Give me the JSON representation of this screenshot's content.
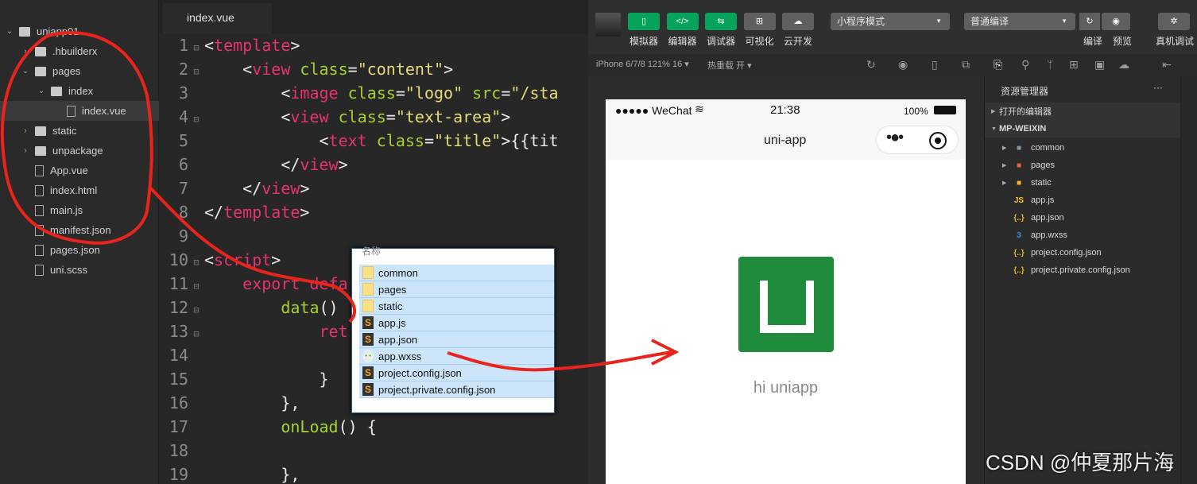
{
  "sidebar": {
    "items": [
      {
        "label": "uniapp01",
        "icon": "project-icon",
        "chev": "⌄",
        "indent": 0
      },
      {
        "label": ".hbuilderx",
        "icon": "folder-icon",
        "chev": "›",
        "indent": 1
      },
      {
        "label": "pages",
        "icon": "folder-icon",
        "chev": "⌄",
        "indent": 1
      },
      {
        "label": "index",
        "icon": "folder-icon",
        "chev": "⌄",
        "indent": 2
      },
      {
        "label": "index.vue",
        "icon": "vue-file-icon",
        "chev": "",
        "indent": 3,
        "selected": true
      },
      {
        "label": "static",
        "icon": "folder-icon",
        "chev": "›",
        "indent": 1
      },
      {
        "label": "unpackage",
        "icon": "folder-icon",
        "chev": "›",
        "indent": 1
      },
      {
        "label": "App.vue",
        "icon": "vue-file-icon",
        "chev": "",
        "indent": 1
      },
      {
        "label": "index.html",
        "icon": "html-file-icon",
        "chev": "",
        "indent": 1
      },
      {
        "label": "main.js",
        "icon": "js-file-icon",
        "chev": "",
        "indent": 1
      },
      {
        "label": "manifest.json",
        "icon": "gear-file-icon",
        "chev": "",
        "indent": 1
      },
      {
        "label": "pages.json",
        "icon": "json-file-icon",
        "chev": "",
        "indent": 1
      },
      {
        "label": "uni.scss",
        "icon": "scss-file-icon",
        "chev": "",
        "indent": 1
      }
    ]
  },
  "editor": {
    "tab": "index.vue",
    "lines": [
      {
        "n": "1",
        "fold": "⊟",
        "indent": 0,
        "tokens": [
          [
            "<",
            "punc"
          ],
          [
            "template",
            "tag"
          ],
          [
            ">",
            "punc"
          ]
        ]
      },
      {
        "n": "2",
        "fold": "⊟",
        "indent": 1,
        "tokens": [
          [
            "<",
            "punc"
          ],
          [
            "view",
            "tag"
          ],
          [
            " class",
            "attr"
          ],
          [
            "=",
            "punc"
          ],
          [
            "\"content\"",
            "str"
          ],
          [
            ">",
            "punc"
          ]
        ]
      },
      {
        "n": "3",
        "fold": "",
        "indent": 2,
        "tokens": [
          [
            "<",
            "punc"
          ],
          [
            "image",
            "tag"
          ],
          [
            " class",
            "attr"
          ],
          [
            "=",
            "punc"
          ],
          [
            "\"logo\"",
            "str"
          ],
          [
            " src",
            "attr"
          ],
          [
            "=",
            "punc"
          ],
          [
            "\"/sta",
            "str"
          ]
        ]
      },
      {
        "n": "4",
        "fold": "⊟",
        "indent": 2,
        "tokens": [
          [
            "<",
            "punc"
          ],
          [
            "view",
            "tag"
          ],
          [
            " class",
            "attr"
          ],
          [
            "=",
            "punc"
          ],
          [
            "\"text-area\"",
            "str"
          ],
          [
            ">",
            "punc"
          ]
        ]
      },
      {
        "n": "5",
        "fold": "",
        "indent": 3,
        "tokens": [
          [
            "<",
            "punc"
          ],
          [
            "text",
            "tag"
          ],
          [
            " class",
            "attr"
          ],
          [
            "=",
            "punc"
          ],
          [
            "\"title\"",
            "str"
          ],
          [
            ">{{tit",
            "punc"
          ]
        ]
      },
      {
        "n": "6",
        "fold": "",
        "indent": 2,
        "tokens": [
          [
            "</",
            "punc"
          ],
          [
            "view",
            "tag"
          ],
          [
            ">",
            "punc"
          ]
        ]
      },
      {
        "n": "7",
        "fold": "",
        "indent": 1,
        "tokens": [
          [
            "</",
            "punc"
          ],
          [
            "view",
            "tag"
          ],
          [
            ">",
            "punc"
          ]
        ]
      },
      {
        "n": "8",
        "fold": "",
        "indent": 0,
        "tokens": [
          [
            "</",
            "punc"
          ],
          [
            "template",
            "tag"
          ],
          [
            ">",
            "punc"
          ]
        ]
      },
      {
        "n": "9",
        "fold": "",
        "indent": 0,
        "tokens": []
      },
      {
        "n": "10",
        "fold": "⊟",
        "indent": 0,
        "tokens": [
          [
            "<",
            "punc"
          ],
          [
            "script",
            "tag"
          ],
          [
            ">",
            "punc"
          ]
        ]
      },
      {
        "n": "11",
        "fold": "⊟",
        "indent": 1,
        "tokens": [
          [
            "export defa",
            "tag"
          ]
        ]
      },
      {
        "n": "12",
        "fold": "⊟",
        "indent": 2,
        "tokens": [
          [
            "data",
            "fn"
          ],
          [
            "()",
            "punc"
          ]
        ]
      },
      {
        "n": "13",
        "fold": "⊟",
        "indent": 3,
        "tokens": [
          [
            "ret",
            "tag"
          ]
        ]
      },
      {
        "n": "14",
        "fold": "",
        "indent": 0,
        "tokens": []
      },
      {
        "n": "15",
        "fold": "",
        "indent": 3,
        "tokens": [
          [
            "}",
            "punc"
          ]
        ]
      },
      {
        "n": "16",
        "fold": "",
        "indent": 2,
        "tokens": [
          [
            "},",
            "punc"
          ]
        ]
      },
      {
        "n": "17",
        "fold": "",
        "indent": 2,
        "tokens": [
          [
            "onLoad",
            "fn"
          ],
          [
            "() {",
            "punc"
          ]
        ]
      },
      {
        "n": "18",
        "fold": "",
        "indent": 0,
        "tokens": []
      },
      {
        "n": "19",
        "fold": "",
        "indent": 2,
        "tokens": [
          [
            "},",
            "punc"
          ]
        ]
      }
    ]
  },
  "popup": {
    "header": "名称",
    "rows": [
      {
        "label": "common",
        "type": "f"
      },
      {
        "label": "pages",
        "type": "f"
      },
      {
        "label": "static",
        "type": "f"
      },
      {
        "label": "app.js",
        "type": "s"
      },
      {
        "label": "app.json",
        "type": "s"
      },
      {
        "label": "app.wxss",
        "type": "w"
      },
      {
        "label": "project.config.json",
        "type": "s"
      },
      {
        "label": "project.private.config.json",
        "type": "s"
      }
    ]
  },
  "devtools": {
    "toolbar": {
      "buttons": [
        {
          "label": "模拟器",
          "icon": "phone-icon",
          "glyph": "▯",
          "green": true
        },
        {
          "label": "编辑器",
          "icon": "code-icon",
          "glyph": "</>",
          "green": true
        },
        {
          "label": "调试器",
          "icon": "sliders-icon",
          "glyph": "⇆",
          "green": true
        },
        {
          "label": "可视化",
          "icon": "layout-icon",
          "glyph": "⊞",
          "green": false
        },
        {
          "label": "云开发",
          "icon": "cloud-icon",
          "glyph": "☁",
          "green": false
        }
      ],
      "mode_select": "小程序模式",
      "compile_select": "普通编译",
      "compile": "编译",
      "preview": "预览",
      "remote_debug": "真机调试"
    },
    "subbar": {
      "device": "iPhone 6/7/8 121% 16 ▾",
      "hot_reload": "热重载 开 ▾"
    },
    "phone": {
      "signal": "●●●●● WeChat",
      "time": "21:38",
      "battery": "100%",
      "nav_title": "uni-app",
      "greeting": "hi uniapp",
      "logo_color": "#1f8c3b"
    },
    "explorer": {
      "title": "资源管理器",
      "more": "···",
      "open_editors": "打开的编辑器",
      "project": "MP-WEIXIN",
      "items": [
        {
          "label": "common",
          "icon": "folder-icon",
          "glyph": "■",
          "color": "#8a97a3",
          "tri": "▶"
        },
        {
          "label": "pages",
          "icon": "pages-folder-icon",
          "glyph": "■",
          "color": "#e8643c",
          "tri": "▶"
        },
        {
          "label": "static",
          "icon": "static-folder-icon",
          "glyph": "■",
          "color": "#f3b52a",
          "tri": "▶"
        },
        {
          "label": "app.js",
          "icon": "js-icon",
          "glyph": "JS",
          "color": "#f3c12a",
          "tri": ""
        },
        {
          "label": "app.json",
          "icon": "json-icon",
          "glyph": "{..}",
          "color": "#e6b422",
          "tri": ""
        },
        {
          "label": "app.wxss",
          "icon": "css-icon",
          "glyph": "3",
          "color": "#3b8fe0",
          "tri": ""
        },
        {
          "label": "project.config.json",
          "icon": "json-icon",
          "glyph": "{..}",
          "color": "#e6b422",
          "tri": ""
        },
        {
          "label": "project.private.config.json",
          "icon": "json-icon",
          "glyph": "{..}",
          "color": "#e6b422",
          "tri": ""
        }
      ]
    }
  },
  "watermark": "CSDN @仲夏那片海"
}
